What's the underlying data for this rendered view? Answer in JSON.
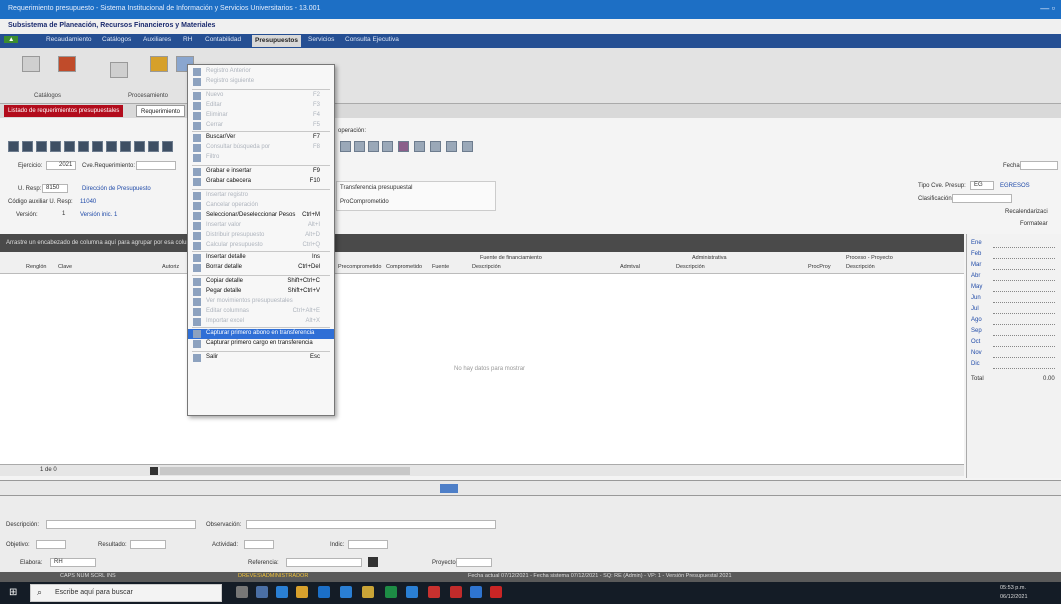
{
  "window": {
    "title": "Requerimiento presupuesto - Sistema Institucional de Información y Servicios Universitarios - 13.001"
  },
  "app": {
    "subtitle": "Subsistema de Planeación, Recursos Financieros y Materiales"
  },
  "menu": {
    "items": [
      "Recaudamiento",
      "Catálogos",
      "Auxiliares",
      "RH",
      "Contabilidad",
      "Presupuestos",
      "Servicios",
      "Consulta Ejecutiva"
    ],
    "active": "Presupuestos"
  },
  "ribbon": {
    "groups": [
      "Catálogos",
      "Procesamiento"
    ]
  },
  "tabs": [
    "Listado de requerimientos presupuestales",
    "Requerimiento"
  ],
  "form": {
    "ejercicio_label": "Ejercicio:",
    "ejercicio_value": "2021",
    "cve_req_label": "Cve.Requerimiento:",
    "ures_label": "U. Resp:",
    "ures_value": "8150",
    "ures_desc": "Dirección de Presupuesto",
    "codigo_label": "Código auxiliar U. Resp:",
    "codigo_value": "11040",
    "version_label": "Versión:",
    "version_value": "1",
    "version_desc": "Versión inic. 1",
    "operacion_label": "operación:",
    "transf_label": "Transferencia presupuestal",
    "procomp_label": "ProComprometido",
    "fecha_label": "Fecha:",
    "tipo_label": "Tipo Cve. Presup:",
    "tipo_value": "EG",
    "tipo_desc": "EGRESOS",
    "clasif_label": "Clasificación:",
    "recalendariza_label": "Recalendarizaci",
    "formatear_label": "Formatear"
  },
  "grid": {
    "group_hint": "Arrastre un encabezado de columna aquí para agrupar por esa columna",
    "group_headers": [
      "Fuente de financiamiento",
      "Administrativa",
      "Proceso - Proyecto"
    ],
    "columns": [
      "Renglón",
      "Clave",
      "Autoriz",
      "Precomprometido",
      "Comprometido",
      "Fuente",
      "Descripción",
      "Admtval",
      "Descripción",
      "ProcProy",
      "Descripción"
    ],
    "empty_text": "No hay datos para mostrar",
    "footer_text": "1 de 0"
  },
  "months": [
    "Ene",
    "Feb",
    "Mar",
    "Abr",
    "May",
    "Jun",
    "Jul",
    "Ago",
    "Sep",
    "Oct",
    "Nov",
    "Dic"
  ],
  "total_label": "Total",
  "total_value": "0.00",
  "lower": {
    "description_label": "Descripción:",
    "observacion_label": "Observación:",
    "objetivo_label": "Objetivo:",
    "resultado_label": "Resultado:",
    "actividad_label": "Actividad:",
    "indic_label": "Indic:",
    "elabora_label": "Elabora:",
    "elabora_value": "RH",
    "referencia_label": "Referencia:",
    "proyecto_label": "Proyecto:"
  },
  "statusbar": {
    "left": "CAPS NUM SCRL INS",
    "user": "DREVES\\ADMINISTRADOR",
    "center": "Fecha actual 07/12/2021 - Fecha sistema 07/12/2021 - SQ: RE (Admin) - VP: 1 - Versión Presupuestal 2021"
  },
  "taskbar": {
    "search_placeholder": "Escribe aquí para buscar",
    "time": "05:53 p.m.",
    "date": "06/12/2021"
  },
  "dropdown": {
    "items": [
      {
        "label": "Registro Anterior",
        "shortcut": "",
        "state": "disabled"
      },
      {
        "label": "Registro siguiente",
        "shortcut": "",
        "state": "disabled"
      },
      {
        "label": "Nuevo",
        "shortcut": "F2",
        "state": "disabled"
      },
      {
        "label": "Editar",
        "shortcut": "F3",
        "state": "disabled"
      },
      {
        "label": "Eliminar",
        "shortcut": "F4",
        "state": "disabled"
      },
      {
        "label": "Cerrar",
        "shortcut": "F5",
        "state": "disabled"
      },
      {
        "label": "Buscar/Ver",
        "shortcut": "F7",
        "state": "enabled"
      },
      {
        "label": "Consultar búsqueda por",
        "shortcut": "F8",
        "state": "disabled"
      },
      {
        "label": "Filtro",
        "shortcut": "",
        "state": "disabled"
      },
      {
        "label": "Grabar e insertar",
        "shortcut": "F9",
        "state": "enabled"
      },
      {
        "label": "Grabar cabecera",
        "shortcut": "F10",
        "state": "enabled"
      },
      {
        "label": "Insertar registro",
        "shortcut": "",
        "state": "disabled"
      },
      {
        "label": "Cancelar operación",
        "shortcut": "",
        "state": "disabled"
      },
      {
        "label": "Seleccionar/Deseleccionar Pesos",
        "shortcut": "Ctrl+M",
        "state": "enabled"
      },
      {
        "label": "Insertar valor",
        "shortcut": "Alt+I",
        "state": "disabled"
      },
      {
        "label": "Distribuir presupuesto",
        "shortcut": "Alt+D",
        "state": "disabled"
      },
      {
        "label": "Calcular presupuesto",
        "shortcut": "Ctrl+Q",
        "state": "disabled"
      },
      {
        "label": "Insertar detalle",
        "shortcut": "Ins",
        "state": "enabled"
      },
      {
        "label": "Borrar detalle",
        "shortcut": "Ctrl+Del",
        "state": "enabled"
      },
      {
        "label": "Copiar detalle",
        "shortcut": "Shift+Ctrl+C",
        "state": "enabled"
      },
      {
        "label": "Pegar detalle",
        "shortcut": "Shift+Ctrl+V",
        "state": "enabled"
      },
      {
        "label": "Ver movimientos presupuestales",
        "shortcut": "",
        "state": "disabled"
      },
      {
        "label": "Editar columnas",
        "shortcut": "Ctrl+Alt+E",
        "state": "disabled"
      },
      {
        "label": "Importar excel",
        "shortcut": "Alt+X",
        "state": "disabled"
      },
      {
        "label": "Capturar primero abono en transferencia",
        "shortcut": "",
        "state": "highlight"
      },
      {
        "label": "Capturar primero cargo en transferencia",
        "shortcut": "",
        "state": "enabled"
      },
      {
        "label": "Salir",
        "shortcut": "Esc",
        "state": "enabled"
      }
    ]
  }
}
